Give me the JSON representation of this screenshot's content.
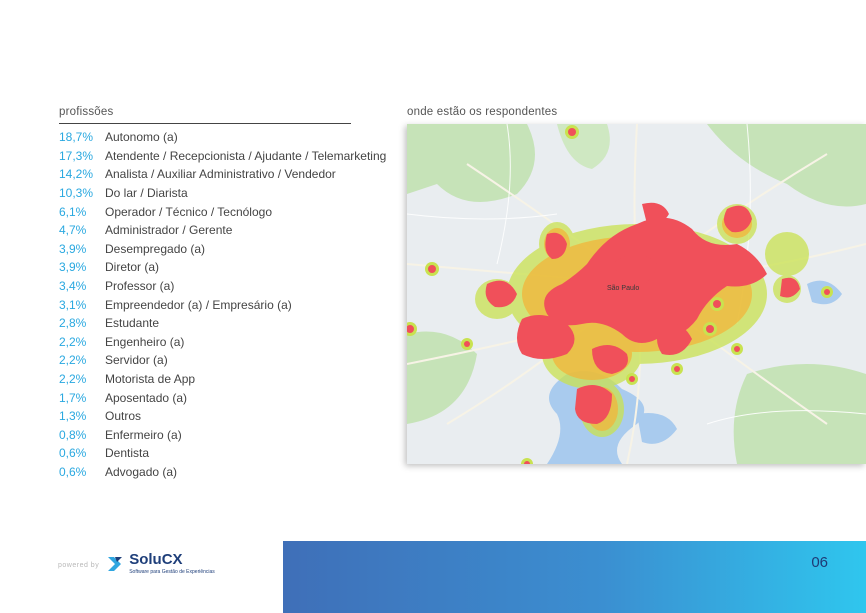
{
  "professions": {
    "title": "profissões",
    "items": [
      {
        "pct": "18,7%",
        "label": "Autonomo (a)"
      },
      {
        "pct": "17,3%",
        "label": "Atendente / Recepcionista / Ajudante / Telemarketing"
      },
      {
        "pct": "14,2%",
        "label": "Analista / Auxiliar Administrativo / Vendedor"
      },
      {
        "pct": "10,3%",
        "label": "Do lar / Diarista"
      },
      {
        "pct": "6,1%",
        "label": "Operador / Técnico / Tecnólogo"
      },
      {
        "pct": "4,7%",
        "label": "Administrador / Gerente"
      },
      {
        "pct": "3,9%",
        "label": "Desempregado (a)"
      },
      {
        "pct": "3,9%",
        "label": "Diretor (a)"
      },
      {
        "pct": "3,4%",
        "label": "Professor (a)"
      },
      {
        "pct": "3,1%",
        "label": "Empreendedor (a) / Empresário (a)"
      },
      {
        "pct": "2,8%",
        "label": "Estudante"
      },
      {
        "pct": "2,2%",
        "label": "Engenheiro (a)"
      },
      {
        "pct": "2,2%",
        "label": "Servidor (a)"
      },
      {
        "pct": "2,2%",
        "label": "Motorista de App"
      },
      {
        "pct": "1,7%",
        "label": "Aposentado (a)"
      },
      {
        "pct": "1,3%",
        "label": "Outros"
      },
      {
        "pct": "0,8%",
        "label": "Enfermeiro (a)"
      },
      {
        "pct": "0,6%",
        "label": "Dentista"
      },
      {
        "pct": "0,6%",
        "label": "Advogado (a)"
      }
    ]
  },
  "map": {
    "title": "onde estão os respondentes",
    "city_label": "São Paulo",
    "colors": {
      "heat": "#f0505a",
      "glow": "#c8e052",
      "land": "#e8ecef",
      "water": "#9fc3e8",
      "green": "#b9dfae"
    }
  },
  "footer": {
    "powered_by": "powered by",
    "brand": "SoluCX",
    "tagline": "Software para Gestão de Experiências",
    "page_number": "06",
    "colors": {
      "bar_start": "#3f6fb8",
      "bar_end": "#2fc6ee",
      "brand": "#1f3f7a"
    }
  }
}
